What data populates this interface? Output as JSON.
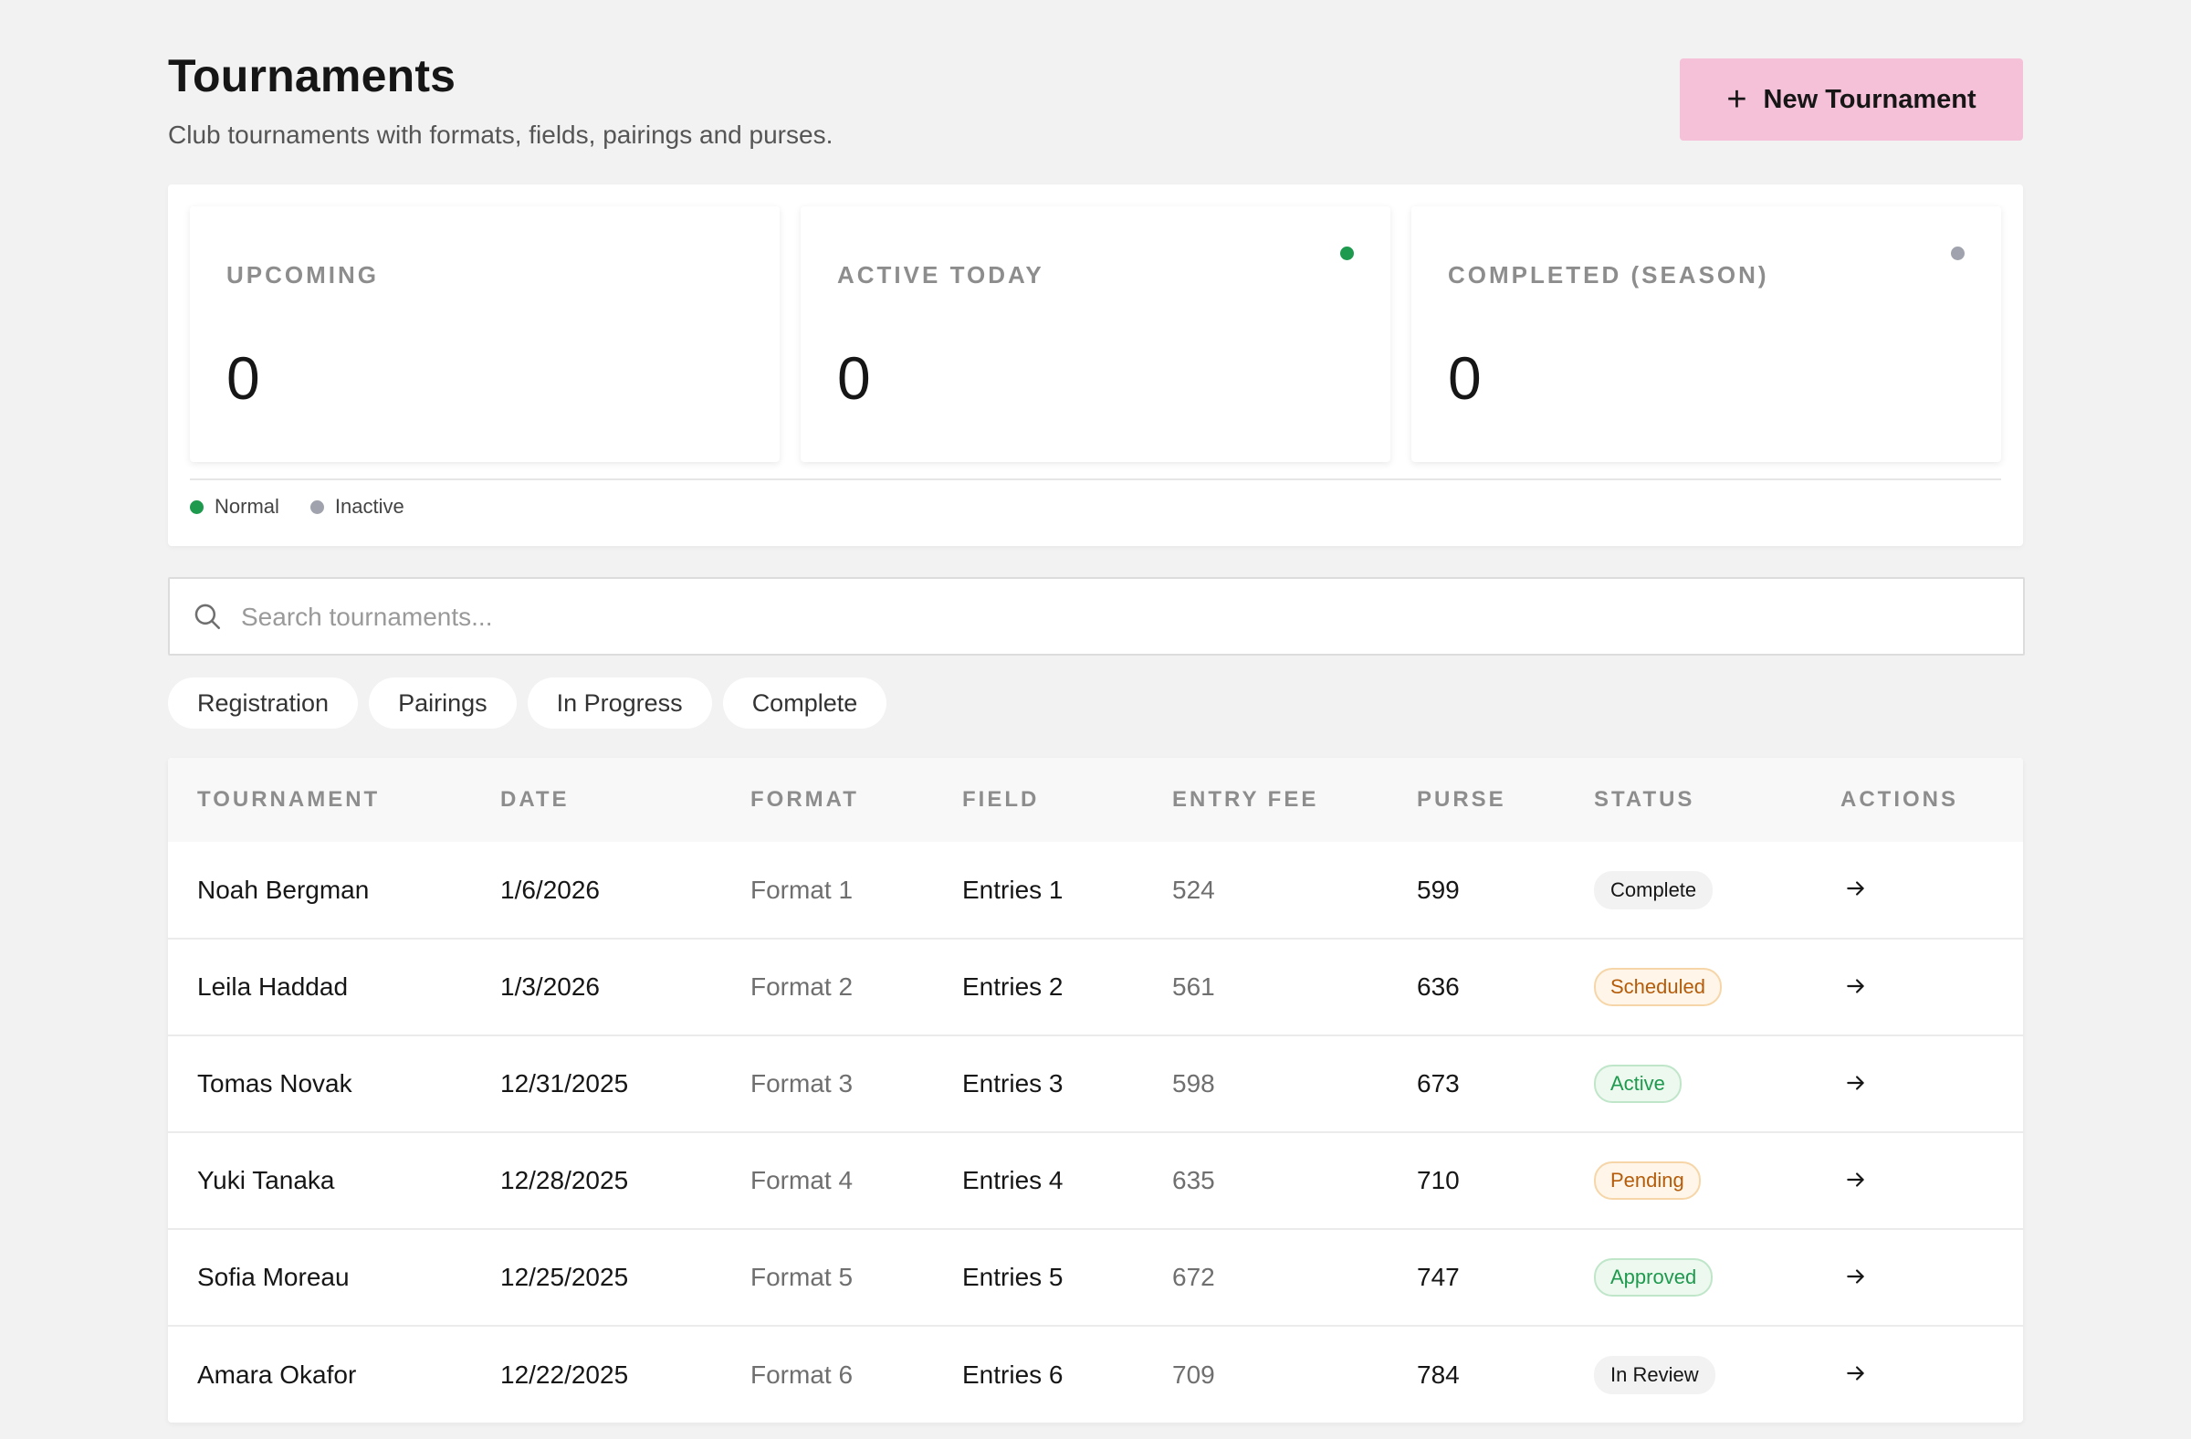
{
  "header": {
    "title": "Tournaments",
    "subtitle": "Club tournaments with formats, fields, pairings and purses.",
    "new_button_label": "New Tournament"
  },
  "stats": [
    {
      "label": "UPCOMING",
      "value": "0"
    },
    {
      "label": "ACTIVE TODAY",
      "value": "0",
      "indicator_color": "#1e9a4e"
    },
    {
      "label": "COMPLETED (SEASON)",
      "value": "0",
      "indicator_color": "#a0a3ad"
    }
  ],
  "legend": [
    {
      "label": "Normal",
      "color": "#1e9a4e"
    },
    {
      "label": "Inactive",
      "color": "#a0a3ad"
    }
  ],
  "search": {
    "placeholder": "Search tournaments...",
    "value": ""
  },
  "filters": [
    "Registration",
    "Pairings",
    "In Progress",
    "Complete"
  ],
  "table": {
    "columns": [
      "TOURNAMENT",
      "DATE",
      "FORMAT",
      "FIELD",
      "ENTRY FEE",
      "PURSE",
      "STATUS",
      "ACTIONS"
    ],
    "rows": [
      {
        "name": "Noah Bergman",
        "date": "1/6/2026",
        "format": "Format 1",
        "field": "Entries 1",
        "entry_fee": "524",
        "purse": "599",
        "status": "Complete",
        "status_tone": "neutral"
      },
      {
        "name": "Leila Haddad",
        "date": "1/3/2026",
        "format": "Format 2",
        "field": "Entries 2",
        "entry_fee": "561",
        "purse": "636",
        "status": "Scheduled",
        "status_tone": "orange"
      },
      {
        "name": "Tomas Novak",
        "date": "12/31/2025",
        "format": "Format 3",
        "field": "Entries 3",
        "entry_fee": "598",
        "purse": "673",
        "status": "Active",
        "status_tone": "green"
      },
      {
        "name": "Yuki Tanaka",
        "date": "12/28/2025",
        "format": "Format 4",
        "field": "Entries 4",
        "entry_fee": "635",
        "purse": "710",
        "status": "Pending",
        "status_tone": "orange"
      },
      {
        "name": "Sofia Moreau",
        "date": "12/25/2025",
        "format": "Format 5",
        "field": "Entries 5",
        "entry_fee": "672",
        "purse": "747",
        "status": "Approved",
        "status_tone": "green"
      },
      {
        "name": "Amara Okafor",
        "date": "12/22/2025",
        "format": "Format 6",
        "field": "Entries 6",
        "entry_fee": "709",
        "purse": "784",
        "status": "In Review",
        "status_tone": "neutral"
      }
    ]
  },
  "colors": {
    "accent_button": "#f5c1d8",
    "background": "#f2f2f2",
    "status_green": "#1e9a4e",
    "status_orange": "#b55c0a"
  },
  "icons": {
    "new_button": "plus-icon",
    "search": "search-icon",
    "row_action": "arrow-right-icon"
  }
}
